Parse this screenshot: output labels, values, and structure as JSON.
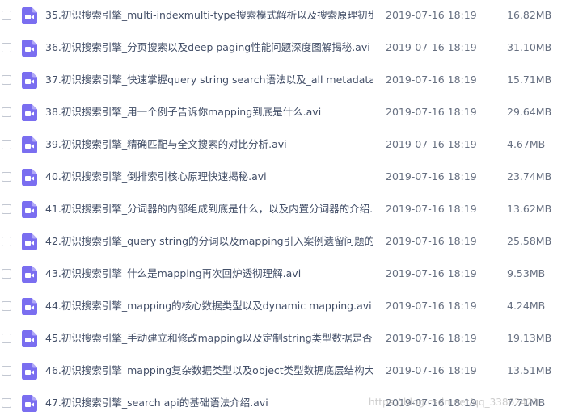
{
  "icon": "video-file-icon",
  "colors": {
    "icon_accent": "#7a6ef0",
    "text": "#424e67",
    "meta_text": "#666f80"
  },
  "files": [
    {
      "name": "35.初识搜索引擎_multi-indexmulti-type搜索模式解析以及搜索原理初步...",
      "date": "2019-07-16 18:19",
      "size": "16.82MB"
    },
    {
      "name": "36.初识搜索引擎_分页搜索以及deep paging性能问题深度图解揭秘.avi",
      "date": "2019-07-16 18:19",
      "size": "31.10MB"
    },
    {
      "name": "37.初识搜索引擎_快速掌握query string search语法以及_all metadata原...",
      "date": "2019-07-16 18:19",
      "size": "15.71MB"
    },
    {
      "name": "38.初识搜索引擎_用一个例子告诉你mapping到底是什么.avi",
      "date": "2019-07-16 18:19",
      "size": "29.64MB"
    },
    {
      "name": "39.初识搜索引擎_精确匹配与全文搜索的对比分析.avi",
      "date": "2019-07-16 18:19",
      "size": "4.67MB"
    },
    {
      "name": "40.初识搜索引擎_倒排索引核心原理快速揭秘.avi",
      "date": "2019-07-16 18:19",
      "size": "23.74MB"
    },
    {
      "name": "41.初识搜索引擎_分词器的内部组成到底是什么，以及内置分词器的介绍.avi",
      "date": "2019-07-16 18:19",
      "size": "13.62MB"
    },
    {
      "name": "42.初识搜索引擎_query string的分词以及mapping引入案例遗留问题的...",
      "date": "2019-07-16 18:19",
      "size": "25.58MB"
    },
    {
      "name": "43.初识搜索引擎_什么是mapping再次回炉透彻理解.avi",
      "date": "2019-07-16 18:19",
      "size": "9.53MB"
    },
    {
      "name": "44.初识搜索引擎_mapping的核心数据类型以及dynamic mapping.avi",
      "date": "2019-07-16 18:19",
      "size": "4.24MB"
    },
    {
      "name": "45.初识搜索引擎_手动建立和修改mapping以及定制string类型数据是否...",
      "date": "2019-07-16 18:19",
      "size": "19.13MB"
    },
    {
      "name": "46.初识搜索引擎_mapping复杂数据类型以及object类型数据底层结构大...",
      "date": "2019-07-16 18:19",
      "size": "13.51MB"
    },
    {
      "name": "47.初识搜索引擎_search api的基础语法介绍.avi",
      "date": "2019-07-16 18:19",
      "size": "7.71MB"
    }
  ],
  "watermark": "https://blog.csdn.net/qq_33862421"
}
